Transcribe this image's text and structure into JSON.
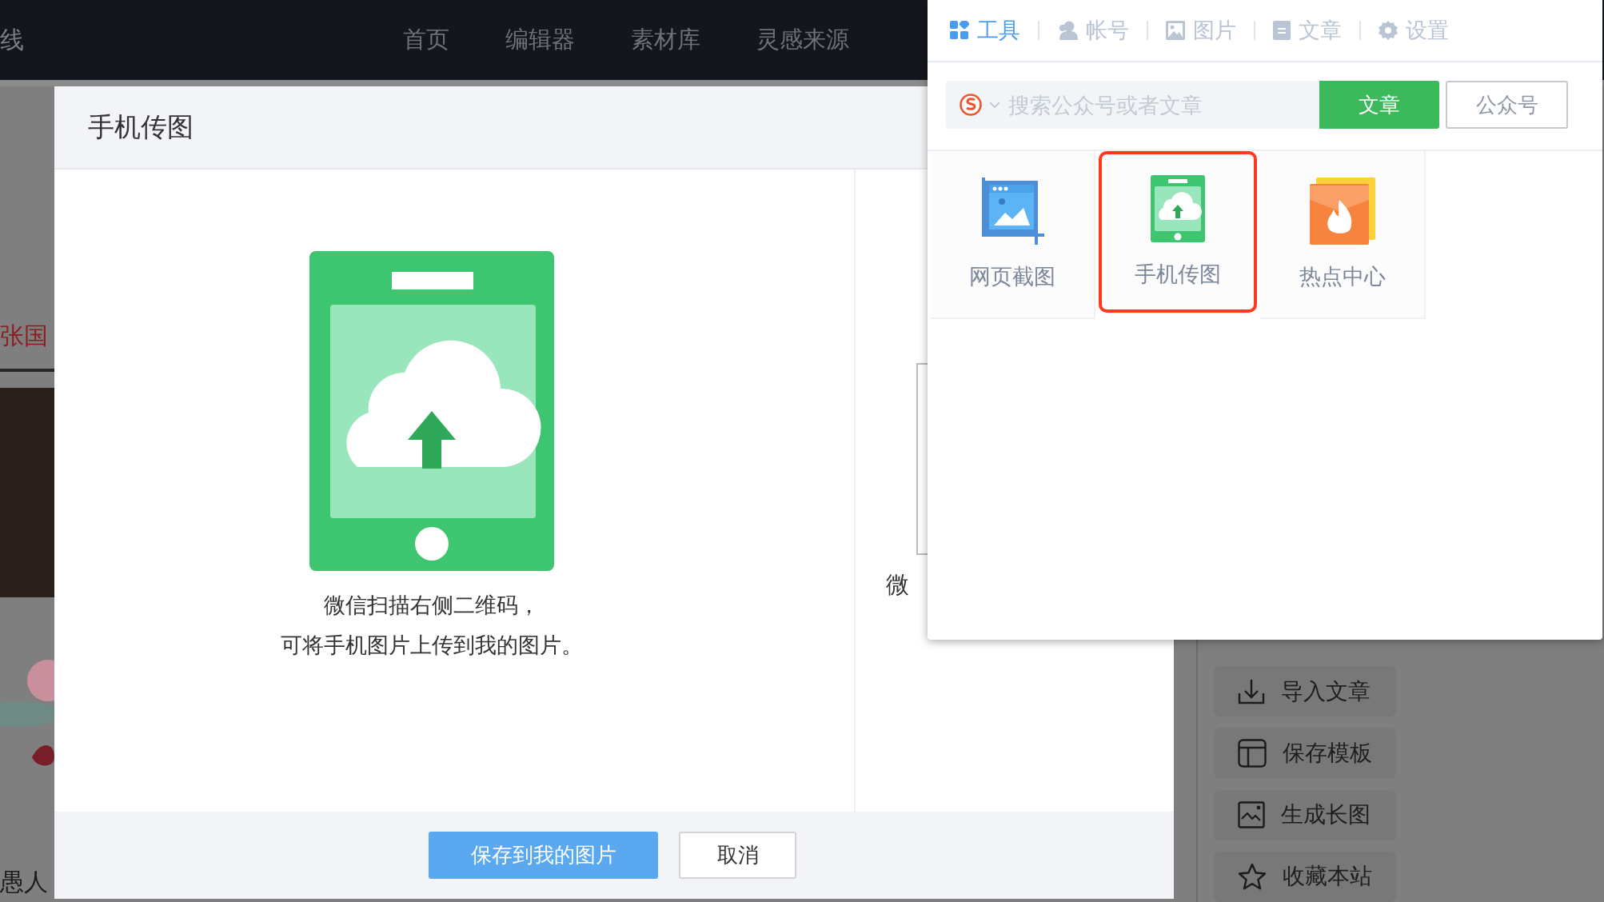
{
  "top_nav": {
    "brand_fragment": "线",
    "items": [
      {
        "label": "首页"
      },
      {
        "label": "编辑器"
      },
      {
        "label": "素材库"
      },
      {
        "label": "灵感来源"
      }
    ]
  },
  "background_page": {
    "headline_fragment": "张国",
    "caption_fragment": "愚人",
    "side_actions": [
      {
        "label": "导入文章",
        "kind": "download"
      },
      {
        "label": "保存模板",
        "kind": "layout"
      },
      {
        "label": "生成长图",
        "kind": "image"
      },
      {
        "label": "收藏本站",
        "kind": "star"
      }
    ]
  },
  "modal": {
    "title": "手机传图",
    "instructions": [
      "微信扫描右侧二维码，",
      "可将手机图片上传到我的图片。"
    ],
    "qr_caption_fragment": "微",
    "buttons": [
      {
        "label": "保存到我的图片",
        "kind": "primary"
      },
      {
        "label": "取消",
        "kind": "default"
      }
    ]
  },
  "popup": {
    "tabs": [
      {
        "label": "工具",
        "kind": "grid",
        "selected": true
      },
      {
        "label": "帐号",
        "kind": "user",
        "selected": false
      },
      {
        "label": "图片",
        "kind": "picture",
        "selected": false
      },
      {
        "label": "文章",
        "kind": "document",
        "selected": false
      },
      {
        "label": "设置",
        "kind": "gear",
        "selected": false
      }
    ],
    "search": {
      "placeholder": "搜索公众号或者文章"
    },
    "search_buttons": [
      {
        "label": "文章",
        "selected": true
      },
      {
        "label": "公众号",
        "selected": false
      }
    ],
    "tools": [
      {
        "label": "网页截图",
        "kind": "screenshot",
        "selected": false
      },
      {
        "label": "手机传图",
        "kind": "phone-upload",
        "selected": true
      },
      {
        "label": "热点中心",
        "kind": "hot",
        "selected": false
      }
    ]
  }
}
